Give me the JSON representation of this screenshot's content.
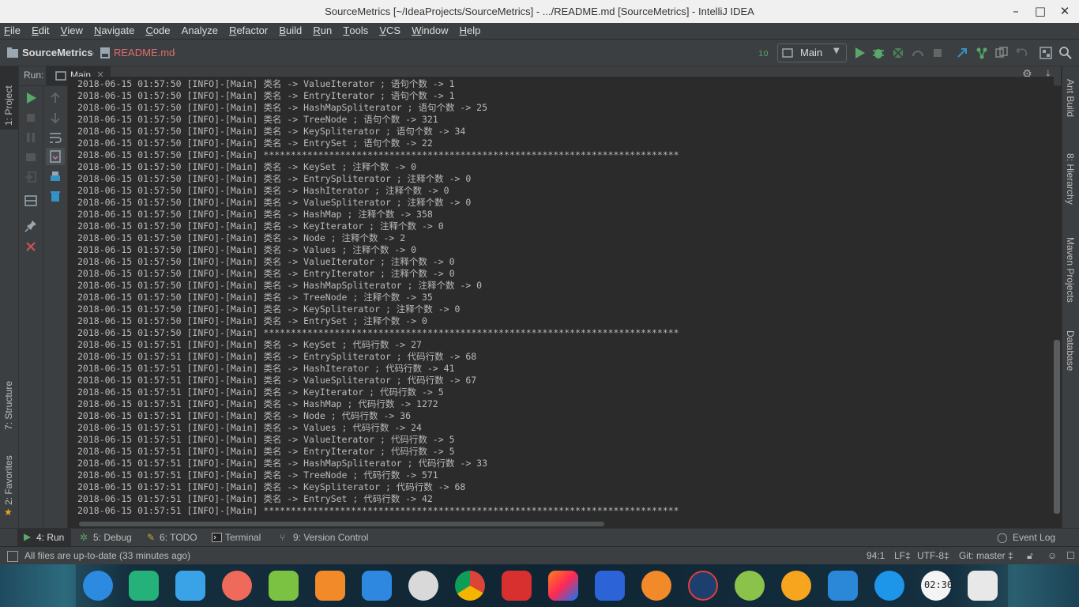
{
  "window": {
    "title": "SourceMetrics [~/IdeaProjects/SourceMetrics] - .../README.md [SourceMetrics] - IntelliJ IDEA",
    "minimize": "–",
    "maximize": "□",
    "close": "✕"
  },
  "menu": [
    {
      "u": "F",
      "rest": "ile"
    },
    {
      "u": "E",
      "rest": "dit"
    },
    {
      "u": "V",
      "rest": "iew"
    },
    {
      "u": "N",
      "rest": "avigate"
    },
    {
      "u": "C",
      "rest": "ode"
    },
    {
      "u": "",
      "rest": "Analyze"
    },
    {
      "u": "R",
      "rest": "efactor"
    },
    {
      "u": "B",
      "rest": "uild"
    },
    {
      "u": "R",
      "rest": "un"
    },
    {
      "u": "T",
      "rest": "ools"
    },
    {
      "u": "V",
      "rest": "CS"
    },
    {
      "u": "W",
      "rest": "indow"
    },
    {
      "u": "H",
      "rest": "elp"
    }
  ],
  "navbar": {
    "project": "SourceMetrics",
    "file": "README.md",
    "run_config": "Main"
  },
  "run_panel": {
    "label": "Run:",
    "tab": "Main",
    "tab_close": "×"
  },
  "left_strip": {
    "project": "1: Project",
    "structure": "7: Structure",
    "favorites": "2: Favorites"
  },
  "right_strip": {
    "ant": "Ant Build",
    "hierarchy": "8: Hierarchy",
    "maven": "Maven Projects",
    "database": "Database"
  },
  "console_lines": [
    "2018-06-15 01:57:50 [INFO]-[Main] 类名 -> ValueIterator ; 语句个数 -> 1",
    "2018-06-15 01:57:50 [INFO]-[Main] 类名 -> EntryIterator ; 语句个数 -> 1",
    "2018-06-15 01:57:50 [INFO]-[Main] 类名 -> HashMapSpliterator ; 语句个数 -> 25",
    "2018-06-15 01:57:50 [INFO]-[Main] 类名 -> TreeNode ; 语句个数 -> 321",
    "2018-06-15 01:57:50 [INFO]-[Main] 类名 -> KeySpliterator ; 语句个数 -> 34",
    "2018-06-15 01:57:50 [INFO]-[Main] 类名 -> EntrySet ; 语句个数 -> 22",
    "2018-06-15 01:57:50 [INFO]-[Main] ****************************************************************************",
    "2018-06-15 01:57:50 [INFO]-[Main] 类名 -> KeySet ; 注释个数 -> 0",
    "2018-06-15 01:57:50 [INFO]-[Main] 类名 -> EntrySpliterator ; 注释个数 -> 0",
    "2018-06-15 01:57:50 [INFO]-[Main] 类名 -> HashIterator ; 注释个数 -> 0",
    "2018-06-15 01:57:50 [INFO]-[Main] 类名 -> ValueSpliterator ; 注释个数 -> 0",
    "2018-06-15 01:57:50 [INFO]-[Main] 类名 -> HashMap ; 注释个数 -> 358",
    "2018-06-15 01:57:50 [INFO]-[Main] 类名 -> KeyIterator ; 注释个数 -> 0",
    "2018-06-15 01:57:50 [INFO]-[Main] 类名 -> Node ; 注释个数 -> 2",
    "2018-06-15 01:57:50 [INFO]-[Main] 类名 -> Values ; 注释个数 -> 0",
    "2018-06-15 01:57:50 [INFO]-[Main] 类名 -> ValueIterator ; 注释个数 -> 0",
    "2018-06-15 01:57:50 [INFO]-[Main] 类名 -> EntryIterator ; 注释个数 -> 0",
    "2018-06-15 01:57:50 [INFO]-[Main] 类名 -> HashMapSpliterator ; 注释个数 -> 0",
    "2018-06-15 01:57:50 [INFO]-[Main] 类名 -> TreeNode ; 注释个数 -> 35",
    "2018-06-15 01:57:50 [INFO]-[Main] 类名 -> KeySpliterator ; 注释个数 -> 0",
    "2018-06-15 01:57:50 [INFO]-[Main] 类名 -> EntrySet ; 注释个数 -> 0",
    "2018-06-15 01:57:50 [INFO]-[Main] ****************************************************************************",
    "2018-06-15 01:57:51 [INFO]-[Main] 类名 -> KeySet ; 代码行数 -> 27",
    "2018-06-15 01:57:51 [INFO]-[Main] 类名 -> EntrySpliterator ; 代码行数 -> 68",
    "2018-06-15 01:57:51 [INFO]-[Main] 类名 -> HashIterator ; 代码行数 -> 41",
    "2018-06-15 01:57:51 [INFO]-[Main] 类名 -> ValueSpliterator ; 代码行数 -> 67",
    "2018-06-15 01:57:51 [INFO]-[Main] 类名 -> KeyIterator ; 代码行数 -> 5",
    "2018-06-15 01:57:51 [INFO]-[Main] 类名 -> HashMap ; 代码行数 -> 1272",
    "2018-06-15 01:57:51 [INFO]-[Main] 类名 -> Node ; 代码行数 -> 36",
    "2018-06-15 01:57:51 [INFO]-[Main] 类名 -> Values ; 代码行数 -> 24",
    "2018-06-15 01:57:51 [INFO]-[Main] 类名 -> ValueIterator ; 代码行数 -> 5",
    "2018-06-15 01:57:51 [INFO]-[Main] 类名 -> EntryIterator ; 代码行数 -> 5",
    "2018-06-15 01:57:51 [INFO]-[Main] 类名 -> HashMapSpliterator ; 代码行数 -> 33",
    "2018-06-15 01:57:51 [INFO]-[Main] 类名 -> TreeNode ; 代码行数 -> 571",
    "2018-06-15 01:57:51 [INFO]-[Main] 类名 -> KeySpliterator ; 代码行数 -> 68",
    "2018-06-15 01:57:51 [INFO]-[Main] 类名 -> EntrySet ; 代码行数 -> 42",
    "2018-06-15 01:57:51 [INFO]-[Main] ****************************************************************************"
  ],
  "tool_tabs": {
    "run": "4: Run",
    "debug": "5: Debug",
    "todo": "6: TODO",
    "terminal": "Terminal",
    "vcs": "9: Version Control",
    "event_log": "Event Log"
  },
  "status": {
    "message": "All files are up-to-date (33 minutes ago)",
    "position": "94:1",
    "line_sep": "LF‡",
    "encoding": "UTF-8‡",
    "git": "Git: master ‡"
  },
  "dock": {
    "clock_text": "02:30",
    "apps": [
      "launcher-icon",
      "files-icon",
      "file-manager-icon",
      "screenshot-icon",
      "music-icon",
      "archive-icon",
      "video-icon",
      "settings-icon",
      "chrome-icon",
      "terminal-icon",
      "intellij-icon",
      "wps-writer-icon",
      "update-icon",
      "sogou-icon",
      "android-icon",
      "circle-app-icon",
      "monitor-icon",
      "network-icon",
      "clock-icon",
      "trash-icon"
    ]
  },
  "colors": {
    "accent_green": "#59a869",
    "run_red": "#c75450",
    "file_red": "#e06c6c"
  }
}
